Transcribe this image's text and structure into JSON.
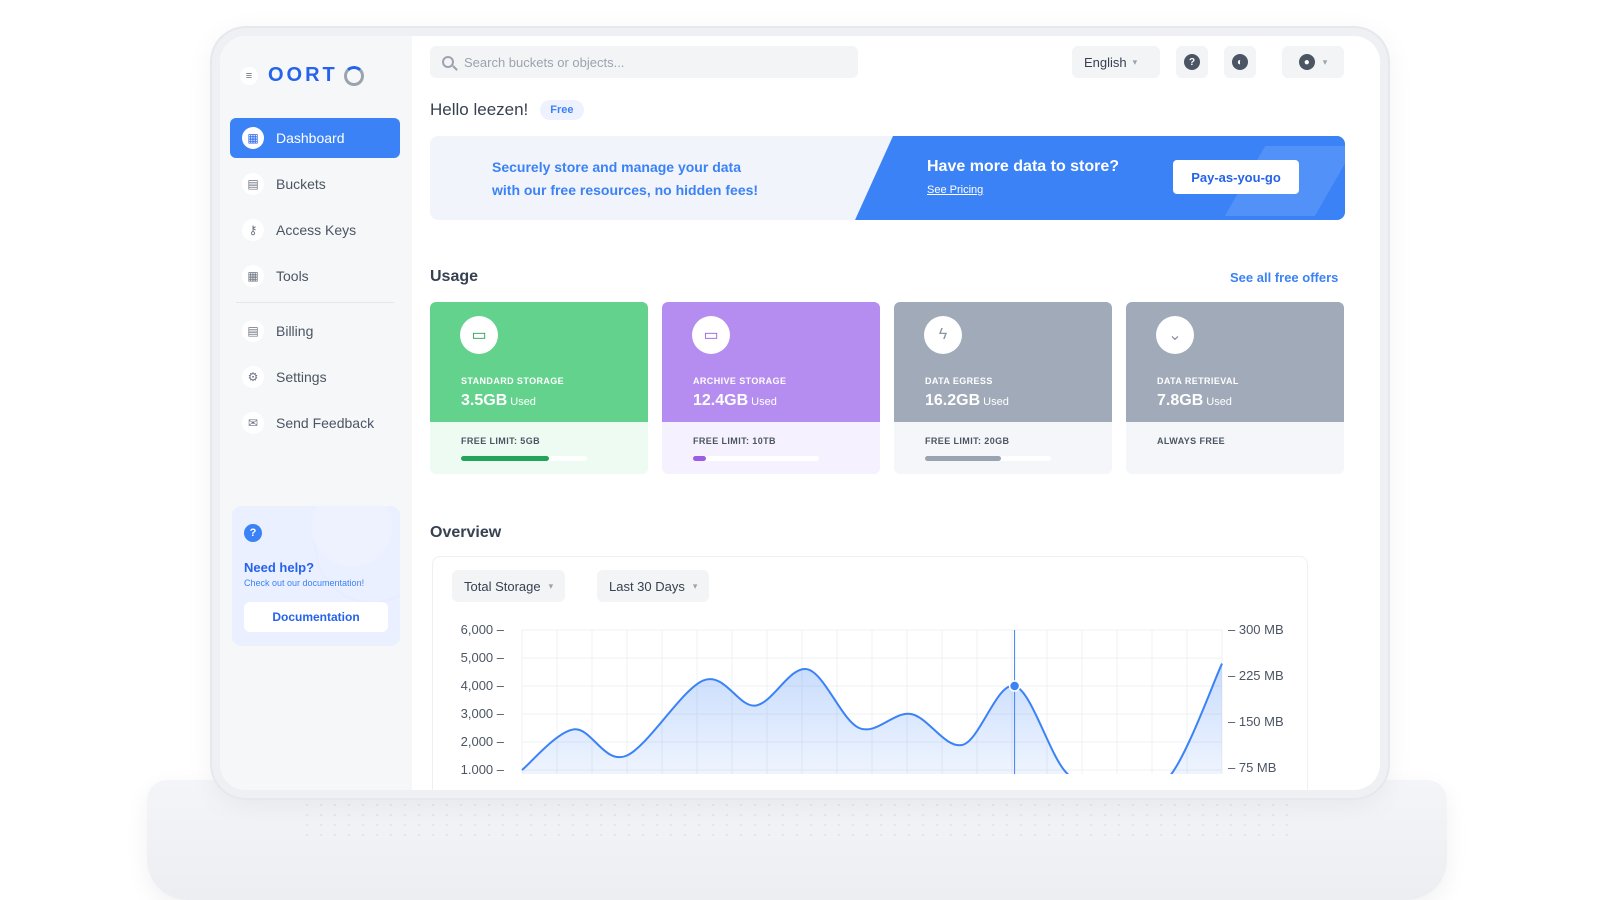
{
  "sidebar": {
    "logo_text": "OORT",
    "items": [
      {
        "label": "Dashboard",
        "icon": "dashboard-icon",
        "glyph": "▦",
        "active": true
      },
      {
        "label": "Buckets",
        "icon": "bucket-icon",
        "glyph": "▤",
        "active": false
      },
      {
        "label": "Access Keys",
        "icon": "key-icon",
        "glyph": "⚷",
        "active": false
      },
      {
        "label": "Tools",
        "icon": "tools-icon",
        "glyph": "▦",
        "active": false
      },
      {
        "label": "Billing",
        "icon": "billing-icon",
        "glyph": "▤",
        "active": false
      },
      {
        "label": "Settings",
        "icon": "gear-icon",
        "glyph": "⚙",
        "active": false
      },
      {
        "label": "Send Feedback",
        "icon": "feedback-icon",
        "glyph": "✉",
        "active": false
      }
    ],
    "help": {
      "title": "Need help?",
      "subtitle": "Check out our documentation!",
      "button": "Documentation"
    }
  },
  "header": {
    "search_placeholder": "Search buckets or objects...",
    "language": "English"
  },
  "greeting": {
    "text": "Hello leezen!",
    "badge": "Free"
  },
  "promo": {
    "left_line1": "Securely store and manage your data",
    "left_line2": "with our free resources, no hidden fees!",
    "title": "Have more data to store?",
    "link": "See Pricing",
    "button": "Pay-as-you-go"
  },
  "usage": {
    "title": "Usage",
    "see_all": "See all free offers",
    "cards": [
      {
        "label": "STANDARD STORAGE",
        "value": "3.5GB",
        "used": "Used",
        "limit": "FREE LIMIT: 5GB",
        "progress": 0.7,
        "top": "#63d28c",
        "bottom": "#eefbf2",
        "bar": "#22a559",
        "icon": "archive-icon",
        "icon_color": "#22a559"
      },
      {
        "label": "ARCHIVE STORAGE",
        "value": "12.4GB",
        "used": "Used",
        "limit": "FREE LIMIT: 10TB",
        "progress": 0.1,
        "top": "#b58cf0",
        "bottom": "#f6f1fe",
        "bar": "#9b5de5",
        "icon": "archive-icon",
        "icon_color": "#9b5de5"
      },
      {
        "label": "DATA EGRESS",
        "value": "16.2GB",
        "used": "Used",
        "limit": "FREE LIMIT: 20GB",
        "progress": 0.6,
        "top": "#a0aab8",
        "bottom": "#f4f6f9",
        "bar": "#9aa3b1",
        "icon": "bolt-icon",
        "icon_color": "#8c95a3"
      },
      {
        "label": "DATA RETRIEVAL",
        "value": "7.8GB",
        "used": "Used",
        "limit": "ALWAYS FREE",
        "progress": null,
        "top": "#a0aab8",
        "bottom": "#f4f6f9",
        "bar": "#9aa3b1",
        "icon": "chevrons-down-icon",
        "icon_color": "#8c95a3"
      }
    ]
  },
  "overview": {
    "title": "Overview",
    "metric": "Total Storage",
    "range": "Last 30 Days"
  },
  "chart_data": {
    "type": "area",
    "title": "",
    "left_ticks": [
      "6,000",
      "5,000",
      "4,000",
      "3,000",
      "2,000",
      "1,000"
    ],
    "right_ticks": [
      "300 MB",
      "225 MB",
      "150 MB",
      "75 MB"
    ],
    "left_ylim": [
      0,
      6000
    ],
    "x": [
      0,
      2,
      4,
      7,
      9,
      11,
      13,
      15,
      17,
      19,
      21,
      23,
      25,
      27
    ],
    "values": [
      1000,
      2450,
      1500,
      4200,
      3300,
      4600,
      2500,
      3000,
      1900,
      4000,
      900,
      200,
      800,
      4800
    ],
    "highlight_index": 9,
    "grid": true,
    "accent": "#3b82f6"
  }
}
